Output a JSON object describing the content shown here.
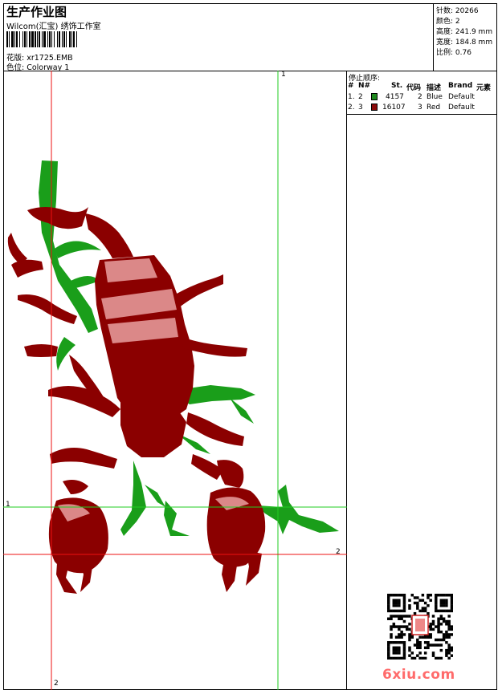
{
  "header": {
    "title": "生产作业图",
    "subtitle": "Wilcom(汇宝) 绣饰工作室",
    "file_label": "花版: xr1725.EMB",
    "colorway_label": "色位: Colorway 1"
  },
  "stats": [
    {
      "label": "针数:",
      "value": "20266"
    },
    {
      "label": "颜色:",
      "value": "2"
    },
    {
      "label": "高度:",
      "value": "241.9 mm"
    },
    {
      "label": "宽度:",
      "value": "184.8 mm"
    },
    {
      "label": "比例:",
      "value": "0.76"
    }
  ],
  "stop_sequence": {
    "title": "停止顺序:",
    "columns": [
      "#",
      "N#",
      "St.",
      "代码",
      "描述",
      "Brand",
      "元素"
    ],
    "rows": [
      {
        "idx": "1.",
        "n": "2",
        "stitches": "4157",
        "code": "2",
        "desc": "Blue",
        "brand": "Default",
        "color": "#1f8a1f"
      },
      {
        "idx": "2.",
        "n": "3",
        "stitches": "16107",
        "code": "3",
        "desc": "Red",
        "brand": "Default",
        "color": "#8b0a0a"
      }
    ]
  },
  "guides": {
    "h1_label": "1",
    "h2_label": "2",
    "v1_label": "1",
    "v2_label": "2"
  },
  "colors": {
    "guide_green": "#22cc22",
    "guide_red": "#ee1111",
    "motif_red": "#8b0000",
    "motif_green": "#1a9e1a"
  },
  "watermark": "6xiu.com"
}
